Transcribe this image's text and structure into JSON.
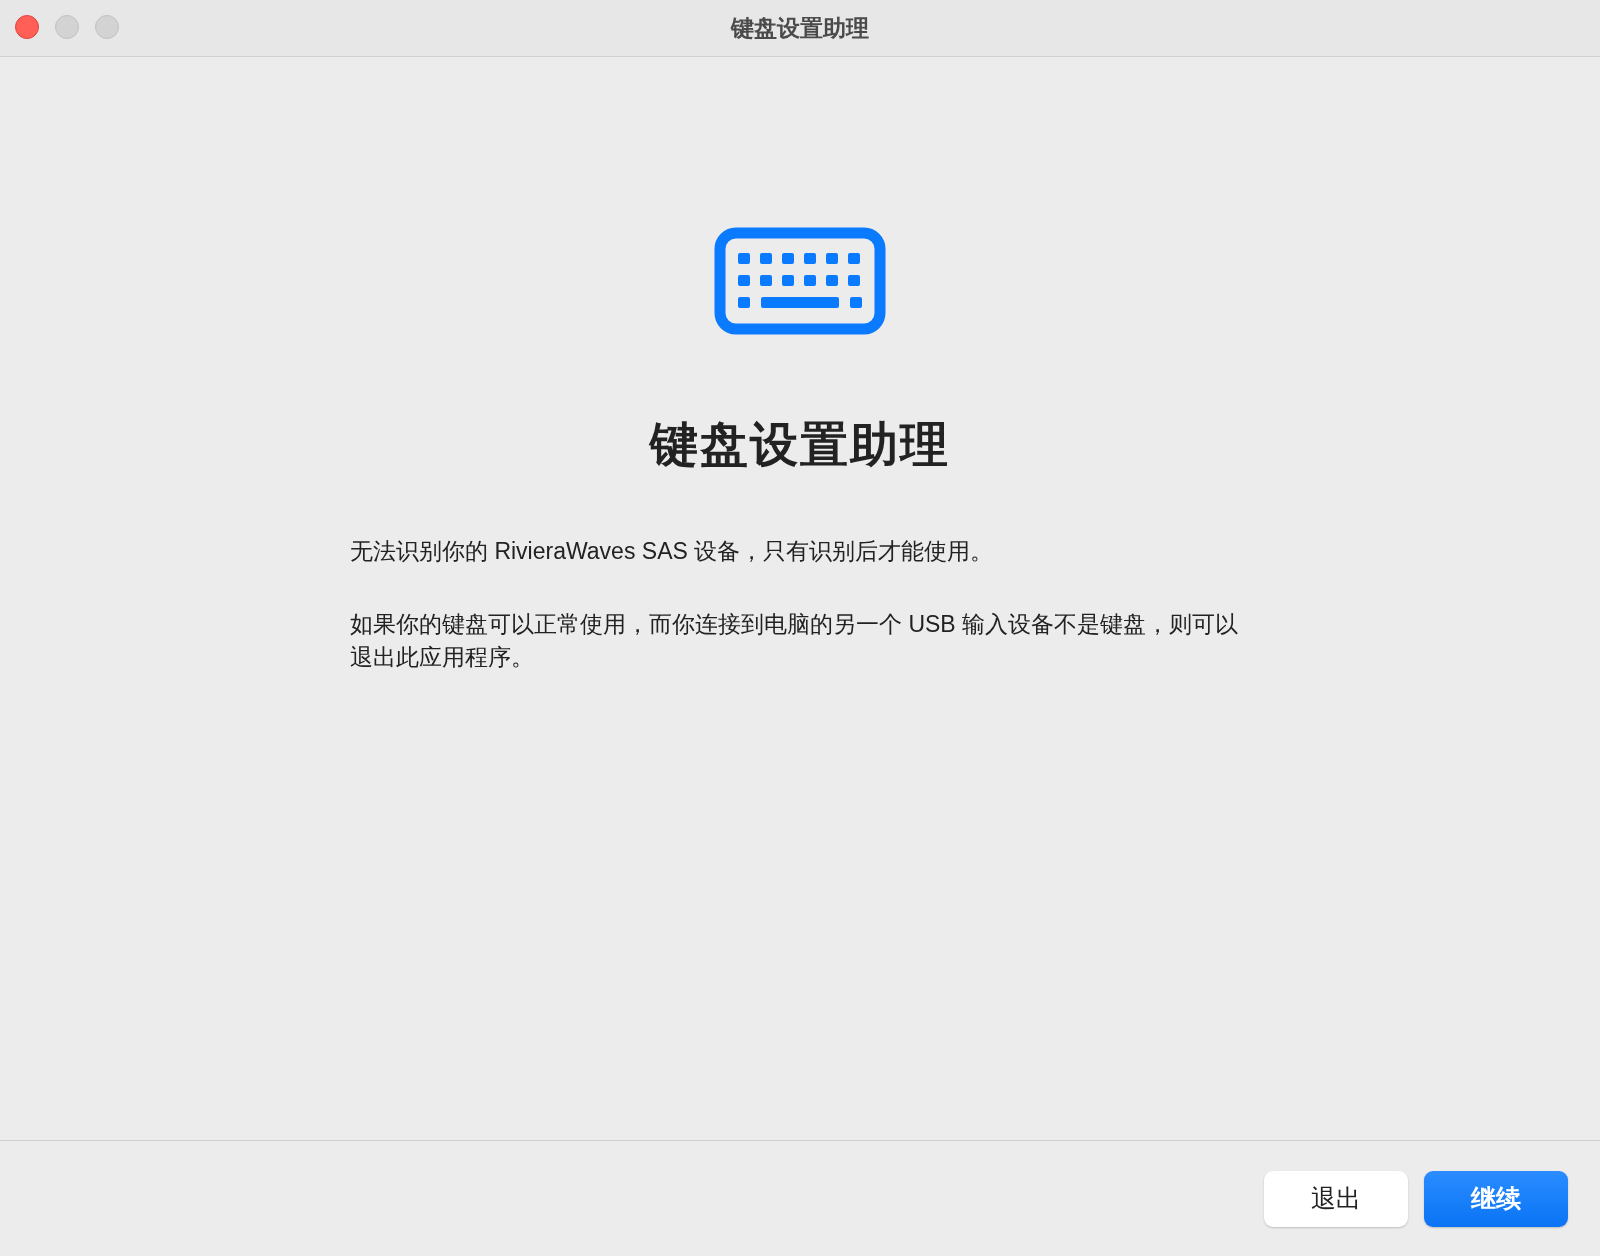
{
  "window": {
    "title": "键盘设置助理"
  },
  "heading": "键盘设置助理",
  "paragraphs": [
    "无法识别你的 RivieraWaves SAS 设备，只有识别后才能使用。",
    "如果你的键盘可以正常使用，而你连接到电脑的另一个 USB 输入设备不是键盘，则可以退出此应用程序。"
  ],
  "buttons": [
    {
      "label": "退出",
      "kind": "secondary"
    },
    {
      "label": "继续",
      "kind": "primary"
    }
  ]
}
